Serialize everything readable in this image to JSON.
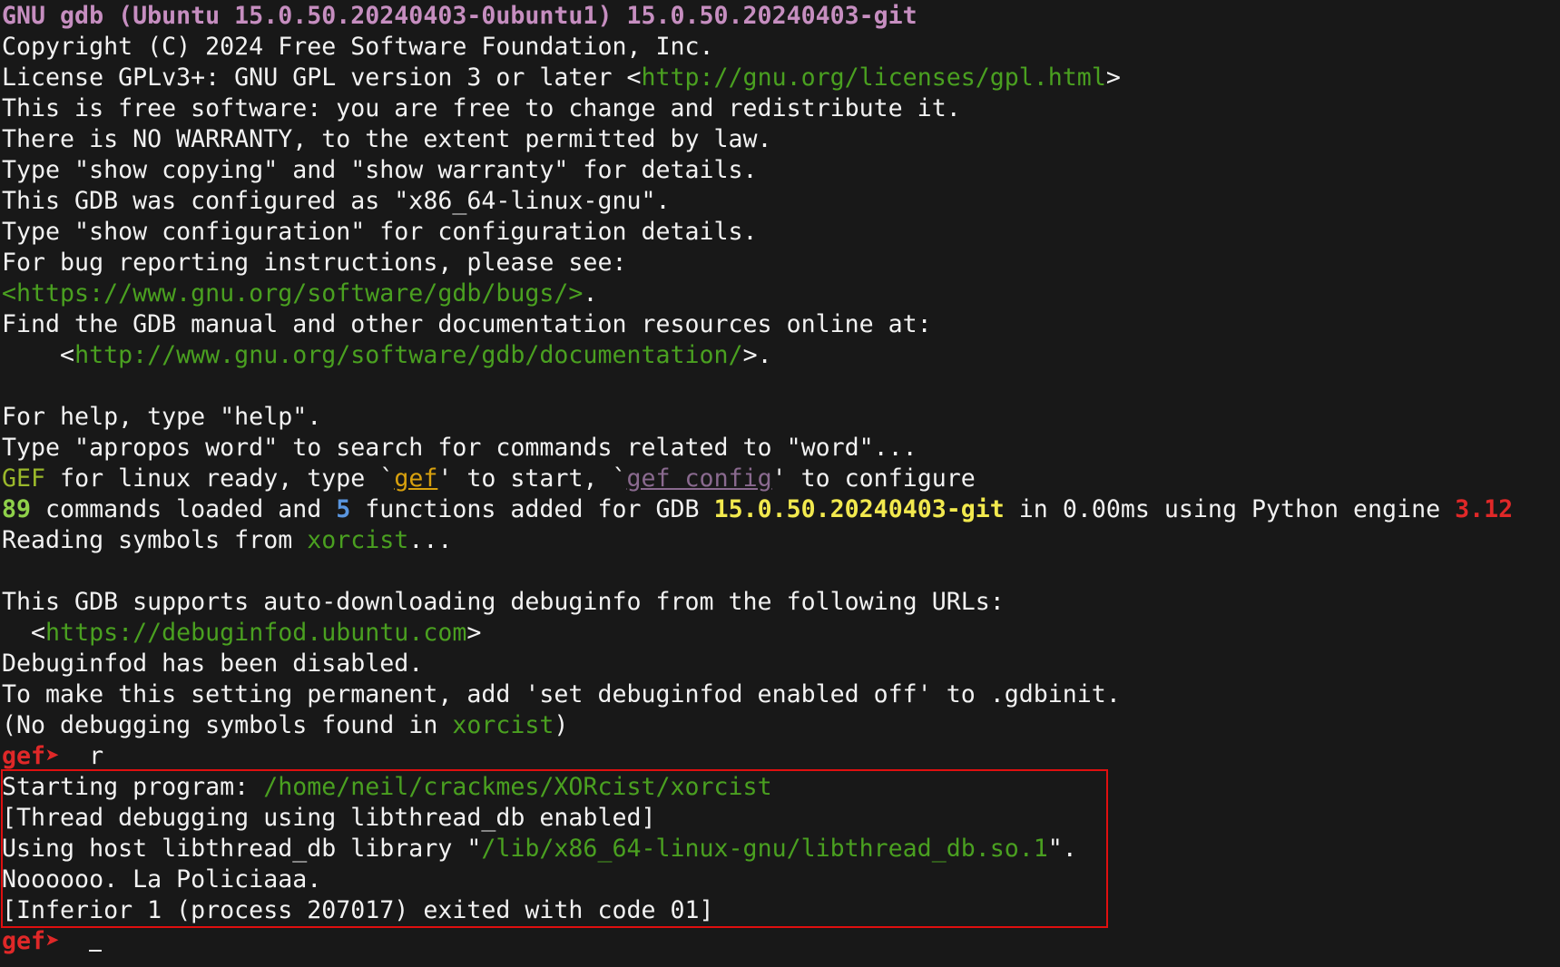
{
  "terminal": {
    "lines": {
      "l1": "GNU gdb (Ubuntu 15.0.50.20240403-0ubuntu1) 15.0.50.20240403-git",
      "l2": "Copyright (C) 2024 Free Software Foundation, Inc.",
      "l3_pre": "License GPLv3+: GNU GPL version 3 or later <",
      "l3_url": "http://gnu.org/licenses/gpl.html",
      "l3_post": ">",
      "l4": "This is free software: you are free to change and redistribute it.",
      "l5": "There is NO WARRANTY, to the extent permitted by law.",
      "l6": "Type \"show copying\" and \"show warranty\" for details.",
      "l7": "This GDB was configured as \"x86_64-linux-gnu\".",
      "l8": "Type \"show configuration\" for configuration details.",
      "l9": "For bug reporting instructions, please see:",
      "l10_url": "<https://www.gnu.org/software/gdb/bugs/>",
      "l10_post": ".",
      "l11": "Find the GDB manual and other documentation resources online at:",
      "l12_pre": "    <",
      "l12_url": "http://www.gnu.org/software/gdb/documentation/",
      "l12_post": ">.",
      "l14": "For help, type \"help\".",
      "l15": "Type \"apropos word\" to search for commands related to \"word\"...",
      "l16_gef": "GEF",
      "l16_a": " for linux ready, type `",
      "l16_cmd1": "gef",
      "l16_b": "' to start, `",
      "l16_cmd2": "gef config",
      "l16_c": "' to configure",
      "l17_count": "89",
      "l17_a": " commands loaded and ",
      "l17_funcs": "5",
      "l17_b": " functions added for GDB ",
      "l17_ver": "15.0.50.20240403-git",
      "l17_c": " in 0.00ms using Python engine ",
      "l17_py": "3.12",
      "l18_pre": "Reading symbols from ",
      "l18_file": "xorcist",
      "l18_post": "...",
      "l20": "This GDB supports auto-downloading debuginfo from the following URLs:",
      "l21_pre": "  <",
      "l21_url": "https://debuginfod.ubuntu.com",
      "l21_post": ">",
      "l22": "Debuginfod has been disabled.",
      "l23": "To make this setting permanent, add 'set debuginfod enabled off' to .gdbinit.",
      "l24_pre": "(No debugging symbols found in ",
      "l24_file": "xorcist",
      "l24_post": ")",
      "prompt": "gef➤ ",
      "cmd_run": " r",
      "l26_pre": "Starting program: ",
      "l26_path": "/home/neil/crackmes/XORcist/xorcist",
      "l27": "[Thread debugging using libthread_db enabled]",
      "l28_pre": "Using host libthread_db library \"",
      "l28_path": "/lib/x86_64-linux-gnu/libthread_db.so.1",
      "l28_post": "\".",
      "l29": "Noooooo. La Policiaaa.",
      "l30": "[Inferior 1 (process 207017) exited with code 01]"
    }
  },
  "colors": {
    "background": "#181818",
    "text": "#f2f2f2",
    "url_green": "#4aa020",
    "prompt_red": "#e02828",
    "highlight_border": "#e00f0f"
  }
}
